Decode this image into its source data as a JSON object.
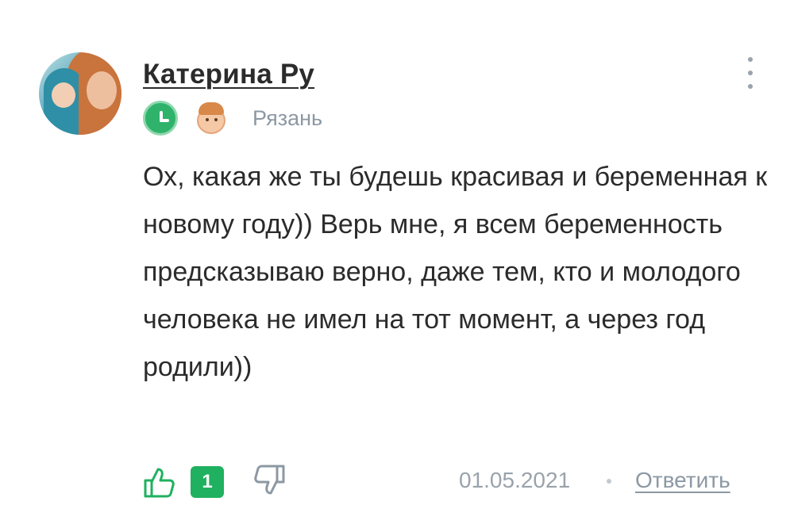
{
  "comment": {
    "author": "Катерина Ру",
    "location": "Рязань",
    "text": "Ох, какая же ты будешь красивая и беременная к новому году)) Верь мне, я всем беременность предсказываю верно, даже тем, кто и молодого человека не имел на тот момент, а через год родили))",
    "likes": "1",
    "date": "01.05.2021",
    "reply_label": "Ответить",
    "icons": {
      "more": "more-vertical-icon",
      "badge_time": "clock-icon",
      "badge_face": "face-icon",
      "like": "thumbs-up-icon",
      "dislike": "thumbs-down-icon"
    },
    "colors": {
      "accent": "#1fb15f",
      "text": "#2b2b2b",
      "muted": "#8c98a3"
    }
  }
}
